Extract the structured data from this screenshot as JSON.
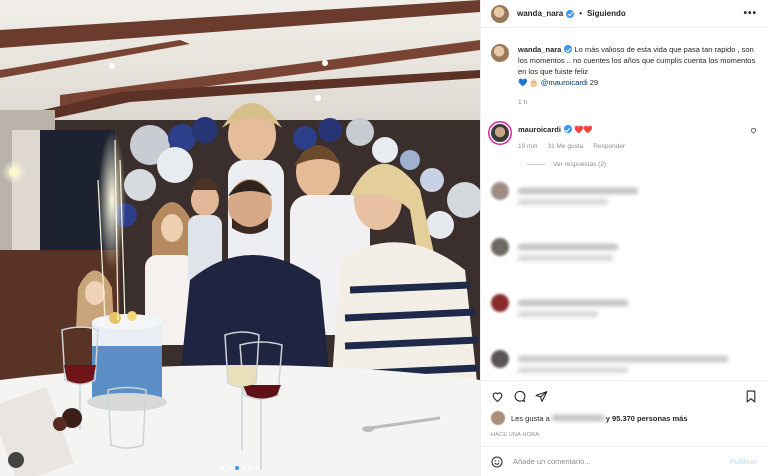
{
  "post": {
    "author": "wanda_nara",
    "follow_label": "Siguiendo",
    "more_label": "•••",
    "caption_text": "Lo más valioso de esta vida que pasa tan rapido , son los momentos .. no cuentes los años que cumplis cuenta los momentos en los que fuiste feliz",
    "caption_emoji": "💙 🎂",
    "caption_mention": "@mauroicardi",
    "caption_number": "29",
    "time_ago": "1 h"
  },
  "comment": {
    "author": "mauroicardi",
    "text": "❤️❤️",
    "time_ago": "19 min",
    "likes_label": "31 Me gusta",
    "reply_label": "Responder",
    "view_replies": "Ver respuestas (2)"
  },
  "likes": {
    "prefix": "Les gusta a",
    "suffix": "y 95.370 personas más"
  },
  "posted_label": "HACE UNA HORA",
  "add_comment": {
    "placeholder": "Añade un comentario...",
    "publish_label": "Publicar"
  },
  "colors": {
    "accent_blue": "#3897f0",
    "heart_red": "#ed4956",
    "border": "#efefef",
    "meta_gray": "#8e8e8e"
  }
}
